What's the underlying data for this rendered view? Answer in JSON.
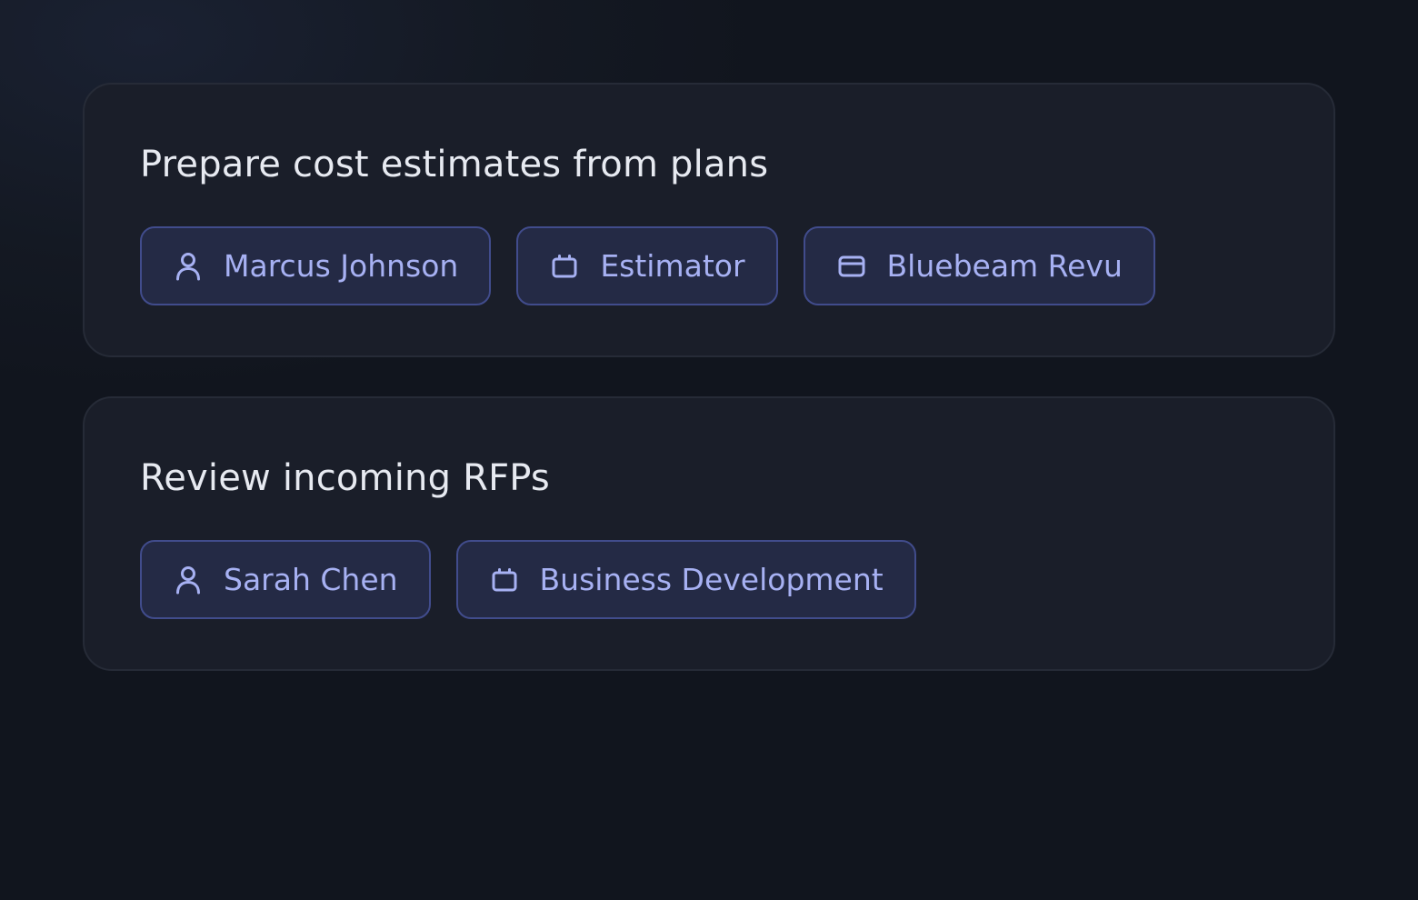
{
  "colors": {
    "background": "#11151e",
    "card": "#1a1e29",
    "card_border": "#262b37",
    "title": "#e7eaf1",
    "chip_fill": "#242a45",
    "chip_border": "#414c8c",
    "chip_text": "#a7b1f3"
  },
  "tasks": [
    {
      "title": "Prepare cost estimates from plans",
      "chips": [
        {
          "icon": "person-icon",
          "label": "Marcus Johnson"
        },
        {
          "icon": "briefcase-icon",
          "label": "Estimator"
        },
        {
          "icon": "credit-card-icon",
          "label": "Bluebeam Revu"
        }
      ]
    },
    {
      "title": "Review incoming RFPs",
      "chips": [
        {
          "icon": "person-icon",
          "label": "Sarah Chen"
        },
        {
          "icon": "briefcase-icon",
          "label": "Business Development"
        }
      ]
    }
  ]
}
